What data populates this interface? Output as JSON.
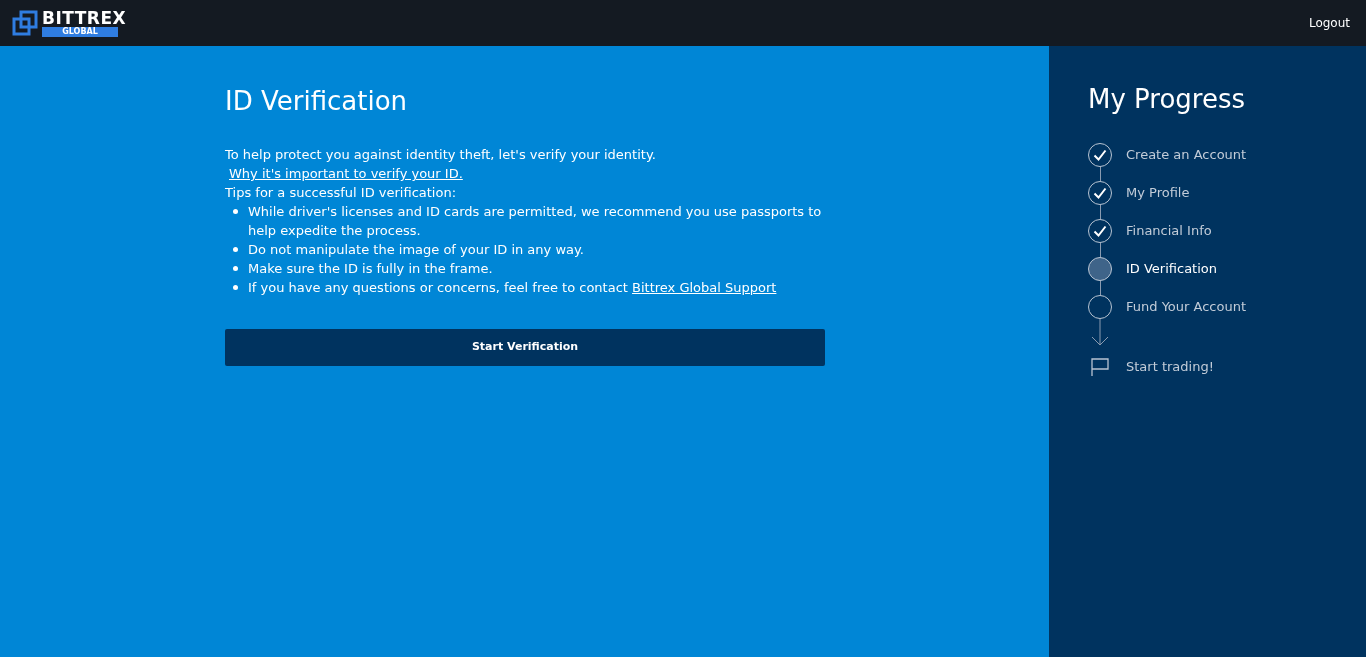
{
  "header": {
    "logo": {
      "name": "BITTREX",
      "sub": "GLOBAL"
    },
    "logout": "Logout"
  },
  "main": {
    "title": "ID Verification",
    "intro": "To help protect you against identity theft, let's verify your identity.",
    "why_link": "Why it's important to verify your ID.",
    "tips_heading": "Tips for a successful ID verification:",
    "tips": [
      {
        "text": "While driver's licenses and ID cards are permitted, we recommend you use passports to help expedite the process."
      },
      {
        "text": "Do not manipulate the image of your ID in any way."
      },
      {
        "text": "Make sure the ID is fully in the frame."
      },
      {
        "text": "If you have any questions or concerns, feel free to contact ",
        "link": "Bittrex Global Support"
      }
    ],
    "button": "Start Verification"
  },
  "progress": {
    "title": "My Progress",
    "steps": [
      {
        "label": "Create an Account",
        "completed": true,
        "selected": false
      },
      {
        "label": "My Profile",
        "completed": true,
        "selected": false
      },
      {
        "label": "Financial Info",
        "completed": true,
        "selected": false
      },
      {
        "label": "ID Verification",
        "completed": false,
        "selected": true
      },
      {
        "label": "Fund Your Account",
        "completed": false,
        "selected": false
      }
    ],
    "finish": "Start trading!"
  }
}
